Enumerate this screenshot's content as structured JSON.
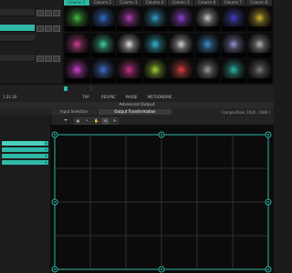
{
  "clip_grid": {
    "columns": [
      "Column 1",
      "Column 2",
      "Column 3",
      "Column 4",
      "Column 5",
      "Column 6",
      "Column 7",
      "Column 8"
    ],
    "active_column": 0,
    "rows": [
      {
        "lane_label": "",
        "clips": [
          {
            "label": "",
            "color": "#3fbf3f"
          },
          {
            "label": "",
            "color": "#2f6fd0"
          },
          {
            "label": "",
            "color": "#b43fb4"
          },
          {
            "label": "",
            "color": "#2fa0c8"
          },
          {
            "label": "",
            "color": "#8f3fd0"
          },
          {
            "label": "",
            "color": "#c8c8c8"
          },
          {
            "label": "",
            "color": "#3f3fc8"
          },
          {
            "label": "",
            "color": "#d0b02f"
          }
        ]
      },
      {
        "lane_label": "",
        "clips": [
          {
            "label": "",
            "color": "#d03f8f"
          },
          {
            "label": "",
            "color": "#3fd0a0"
          },
          {
            "label": "",
            "color": "#e0e0e0"
          },
          {
            "label": "",
            "color": "#2fb8d0"
          },
          {
            "label": "",
            "color": "#d0d0d0"
          },
          {
            "label": "",
            "color": "#3f8fd0"
          },
          {
            "label": "",
            "color": "#8f8fd0"
          },
          {
            "label": "",
            "color": "#b0b0b0"
          }
        ]
      },
      {
        "lane_label": "",
        "clips": [
          {
            "label": "",
            "color": "#d03fd0"
          },
          {
            "label": "",
            "color": "#3f6fd0"
          },
          {
            "label": "",
            "color": "#d02f8f"
          },
          {
            "label": "",
            "color": "#a0d02f"
          },
          {
            "label": "",
            "color": "#e03f3f"
          },
          {
            "label": "",
            "color": "#9a9a9a"
          },
          {
            "label": "",
            "color": "#2fb8a6"
          },
          {
            "label": "",
            "color": "#7a7a7a"
          }
        ]
      }
    ]
  },
  "transport": {
    "bpm": "1:31:20",
    "buttons": [
      "TAP",
      "RESYNC",
      "PAUSE",
      "METRONOME"
    ],
    "layer_buttons": [
      "",
      ""
    ]
  },
  "advanced_output": {
    "title": "Advanced Output",
    "tabs": [
      "Input Selection",
      "Output Transformation"
    ],
    "active_tab": 1,
    "composition_info": "Composition( 1920, 1080 )",
    "side_header": "",
    "side_items": [
      "",
      "",
      "",
      ""
    ],
    "zoom": "",
    "help_text": ""
  },
  "colors": {
    "accent": "#2fb8a6",
    "grid_line": "#3a3a3a"
  }
}
